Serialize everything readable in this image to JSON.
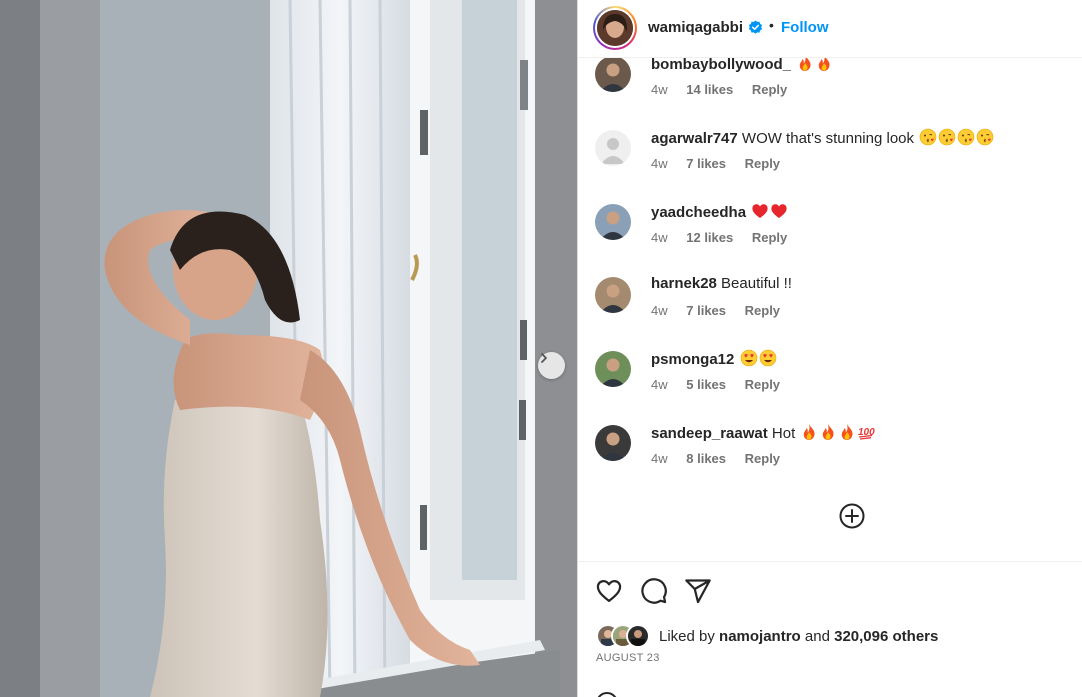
{
  "post": {
    "username": "wamiqagabbi",
    "separator": "•",
    "follow_label": "Follow"
  },
  "comments": [
    {
      "username": "bombaybollywood_",
      "text": "",
      "emoji": [
        "fire",
        "fire"
      ],
      "time": "4w",
      "likes": "14 likes",
      "reply": "Reply",
      "avatar_color": "#6b5a4c"
    },
    {
      "username": "agarwalr747",
      "text": "WOW that's stunning look",
      "emoji": [
        "kiss",
        "kiss",
        "kiss",
        "kiss"
      ],
      "time": "4w",
      "likes": "7 likes",
      "reply": "Reply",
      "avatar_color": "#dbdbdb"
    },
    {
      "username": "yaadcheedha",
      "text": "",
      "emoji": [
        "heart",
        "heart"
      ],
      "time": "4w",
      "likes": "12 likes",
      "reply": "Reply",
      "avatar_color": "#8aa0b6"
    },
    {
      "username": "harnek28",
      "text": "Beautiful !!",
      "emoji": [],
      "time": "4w",
      "likes": "7 likes",
      "reply": "Reply",
      "avatar_color": "#a48a6e"
    },
    {
      "username": "psmonga12",
      "text": "",
      "emoji": [
        "hearteyes",
        "hearteyes"
      ],
      "time": "4w",
      "likes": "5 likes",
      "reply": "Reply",
      "avatar_color": "#6f8f5a"
    },
    {
      "username": "sandeep_raawat",
      "text": "Hot",
      "emoji": [
        "fire",
        "fire",
        "fire",
        "hundred"
      ],
      "time": "4w",
      "likes": "8 likes",
      "reply": "Reply",
      "avatar_color": "#3a3a3a"
    }
  ],
  "likes": {
    "prefix": "Liked by",
    "user": "namojantro",
    "conjunction": "and",
    "others": "320,096 others"
  },
  "date": "AUGUST 23",
  "colors": {
    "accent": "#0095f6",
    "text": "#262626",
    "secondary": "#737373",
    "border": "#dbdbdb"
  }
}
